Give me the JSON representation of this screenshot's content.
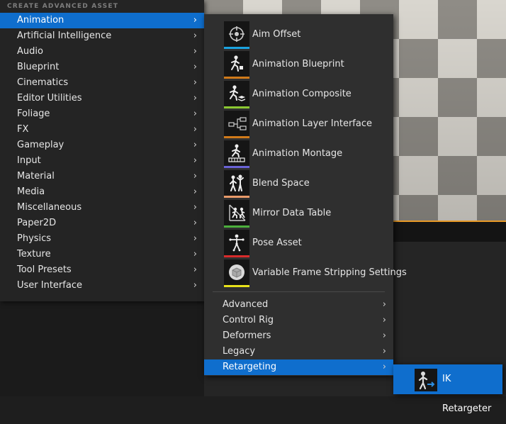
{
  "menu": {
    "header": "CREATE ADVANCED ASSET",
    "items": [
      {
        "label": "Animation",
        "active": true
      },
      {
        "label": "Artificial Intelligence"
      },
      {
        "label": "Audio"
      },
      {
        "label": "Blueprint"
      },
      {
        "label": "Cinematics"
      },
      {
        "label": "Editor Utilities"
      },
      {
        "label": "Foliage"
      },
      {
        "label": "FX"
      },
      {
        "label": "Gameplay"
      },
      {
        "label": "Input"
      },
      {
        "label": "Material"
      },
      {
        "label": "Media"
      },
      {
        "label": "Miscellaneous"
      },
      {
        "label": "Paper2D"
      },
      {
        "label": "Physics"
      },
      {
        "label": "Texture"
      },
      {
        "label": "Tool Presets"
      },
      {
        "label": "User Interface"
      }
    ],
    "chevron": "›"
  },
  "animation_submenu": {
    "assets": [
      {
        "label": "Aim Offset",
        "icon": "aim-offset-icon",
        "color": "#1aa3e0"
      },
      {
        "label": "Animation Blueprint",
        "icon": "animation-blueprint-icon",
        "color": "#d07a1a"
      },
      {
        "label": "Animation Composite",
        "icon": "animation-composite-icon",
        "color": "#8bc832"
      },
      {
        "label": "Animation Layer Interface",
        "icon": "animation-layer-interface-icon",
        "color": "#d07a1a"
      },
      {
        "label": "Animation Montage",
        "icon": "animation-montage-icon",
        "color": "#6a63d6"
      },
      {
        "label": "Blend Space",
        "icon": "blend-space-icon",
        "color": "#e89a6a"
      },
      {
        "label": "Mirror Data Table",
        "icon": "mirror-data-table-icon",
        "color": "#4caf3c"
      },
      {
        "label": "Pose Asset",
        "icon": "pose-asset-icon",
        "color": "#d92b2b"
      },
      {
        "label": "Variable Frame Stripping Settings",
        "icon": "variable-frame-stripping-icon",
        "color": "#e8e21a"
      }
    ],
    "submenus": [
      {
        "label": "Advanced"
      },
      {
        "label": "Control Rig"
      },
      {
        "label": "Deformers"
      },
      {
        "label": "Legacy"
      },
      {
        "label": "Retargeting",
        "active": true
      }
    ]
  },
  "retargeting_submenu": {
    "items": [
      {
        "label": "IK Retargeter",
        "icon": "ik-retargeter-icon"
      }
    ]
  }
}
